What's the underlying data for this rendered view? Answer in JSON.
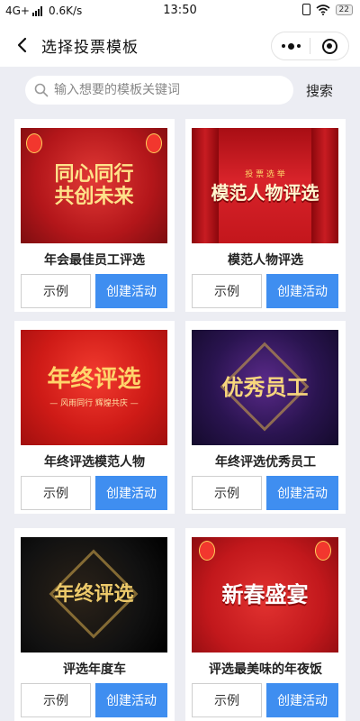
{
  "status_bar": {
    "network": "4G+",
    "speed": "0.6K/s",
    "time": "13:50",
    "battery": "22"
  },
  "nav": {
    "title": "选择投票模板"
  },
  "search": {
    "placeholder": "输入想要的模板关键词",
    "button_label": "搜索"
  },
  "buttons": {
    "example_label": "示例",
    "create_label": "创建活动",
    "create_color": "#3f8ef0"
  },
  "templates": [
    {
      "title": "年会最佳员工评选",
      "art_text": "同心同行\n共创未来",
      "art_sub": ""
    },
    {
      "title": "模范人物评选",
      "art_text": "模范人物评选",
      "art_tag": "投 票 选 举"
    },
    {
      "title": "年终评选模范人物",
      "art_text": "年终评选",
      "art_sub": "— 风雨同行  辉煌共庆 —"
    },
    {
      "title": "年终评选优秀员工",
      "art_text": "优秀员工",
      "art_sub": ""
    },
    {
      "title": "评选年度车",
      "art_text": "年终评选",
      "art_sub": ""
    },
    {
      "title": "评选最美味的年夜饭",
      "art_text": "新春盛宴",
      "art_sub": ""
    }
  ]
}
